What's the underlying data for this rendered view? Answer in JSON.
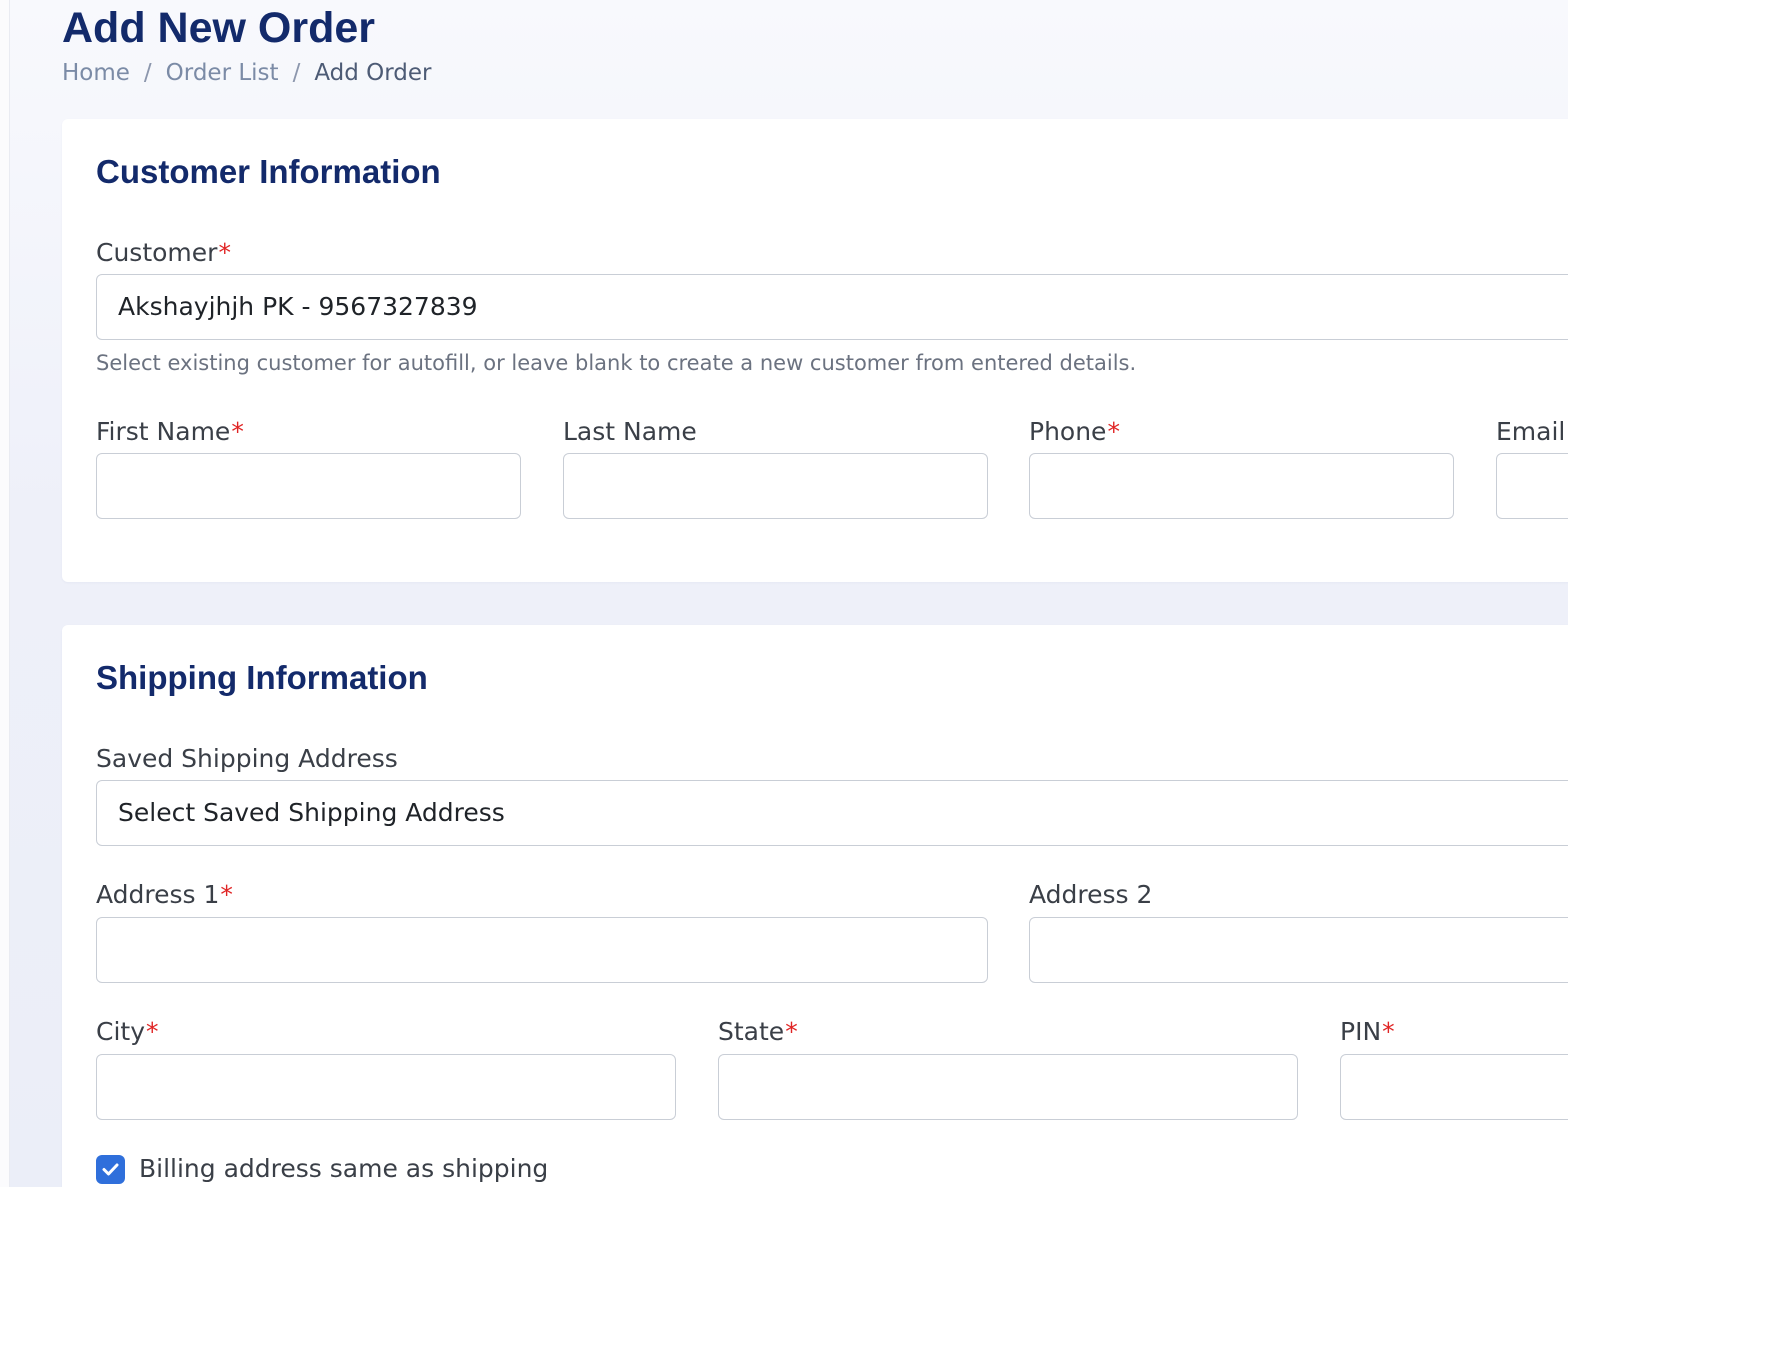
{
  "page": {
    "title": "Add New Order",
    "breadcrumb": {
      "home": "Home",
      "separator": "/",
      "order_list": "Order List",
      "current": "Add Order"
    }
  },
  "colors": {
    "title": "#132a6b",
    "required_mark": "#e02424",
    "checkbox": "#2f6fdb"
  },
  "required_mark": "*",
  "customer_section": {
    "title": "Customer Information",
    "customer_label": "Customer",
    "customer_value": "Akshayjhjh PK - 9567327839",
    "help_text": "Select existing customer for autofill, or leave blank to create a new customer from entered details.",
    "first_name": {
      "label": "First Name",
      "value": ""
    },
    "last_name": {
      "label": "Last Name",
      "value": ""
    },
    "phone": {
      "label": "Phone",
      "value": ""
    },
    "email": {
      "label": "Email",
      "value": ""
    }
  },
  "shipping_section": {
    "title": "Shipping Information",
    "saved_address_label": "Saved Shipping Address",
    "saved_address_value": "Select Saved Shipping Address",
    "address1": {
      "label": "Address 1",
      "value": ""
    },
    "address2": {
      "label": "Address 2",
      "value": ""
    },
    "city": {
      "label": "City",
      "value": ""
    },
    "state": {
      "label": "State",
      "value": ""
    },
    "pin": {
      "label": "PIN",
      "value": ""
    },
    "billing_same": {
      "label": "Billing address same as shipping",
      "checked": true,
      "icon": "checkmark-icon"
    }
  }
}
